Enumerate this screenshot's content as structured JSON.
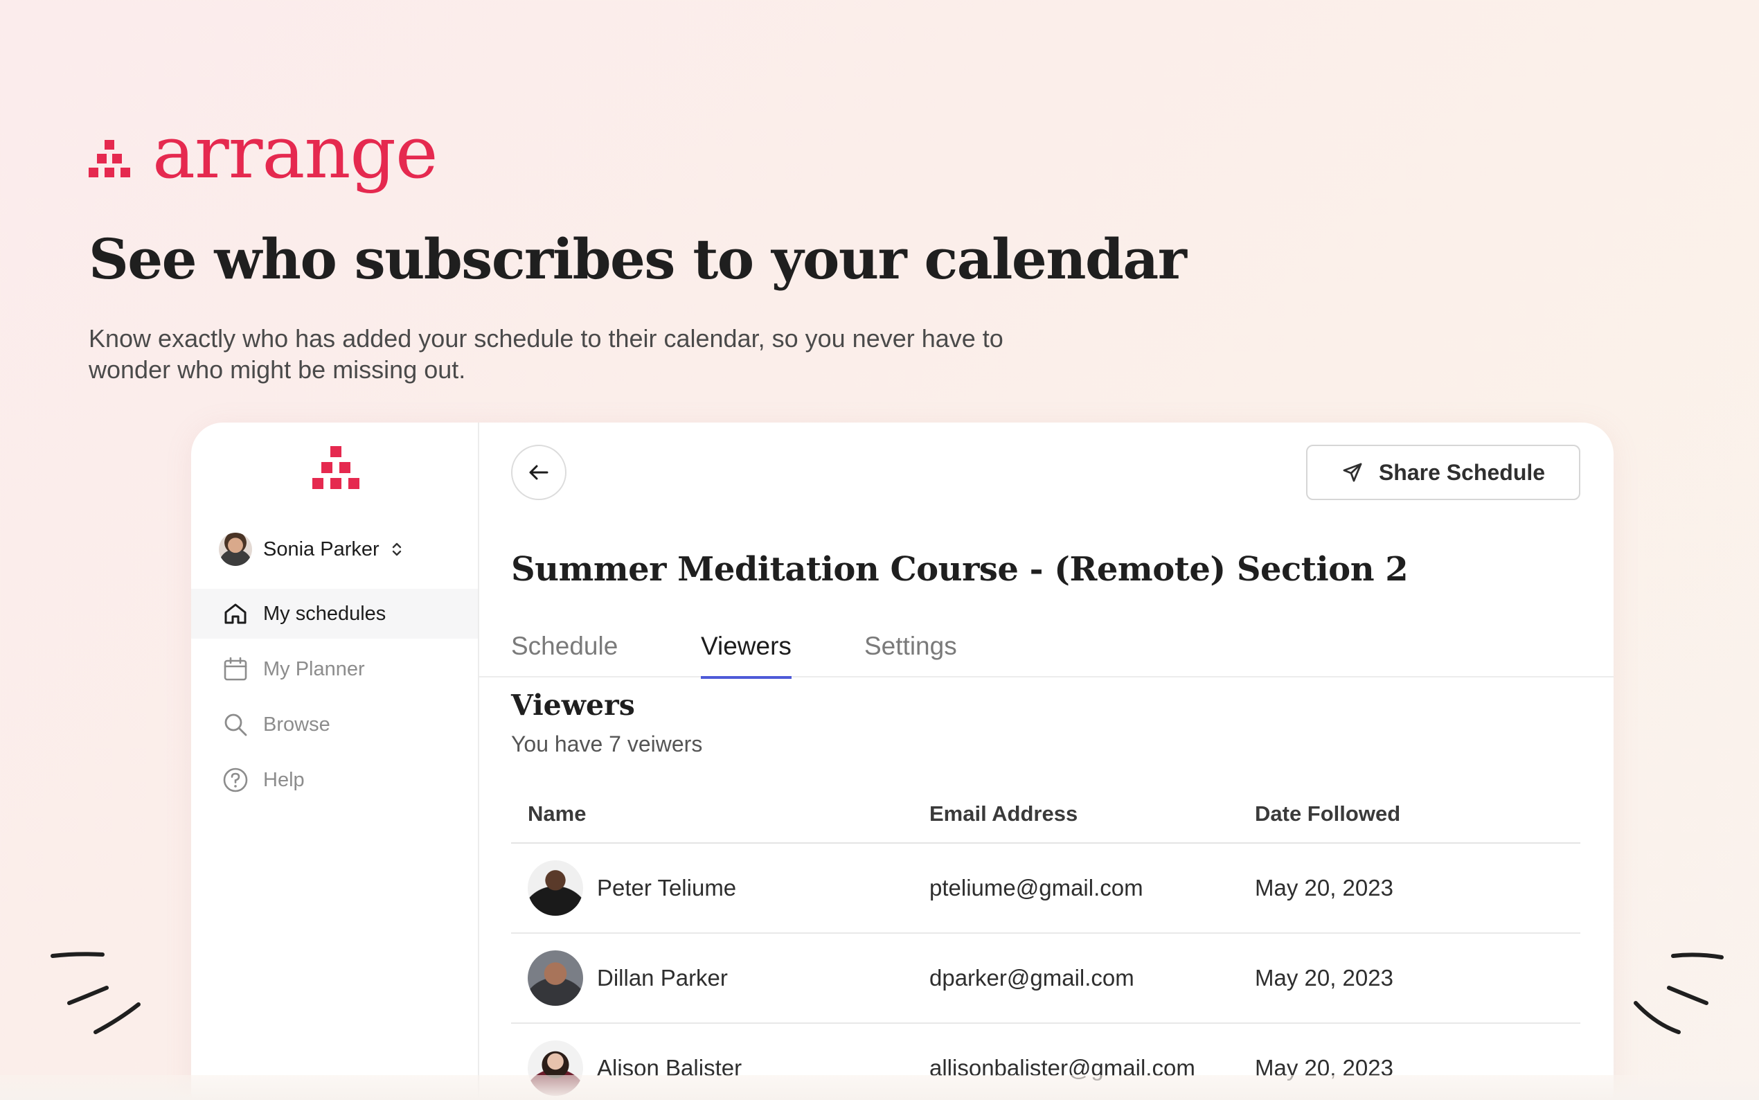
{
  "brand": {
    "name": "arrange",
    "color": "#e5294f"
  },
  "hero": {
    "headline": "See who subscribes to your calendar",
    "subhead": "Know exactly who has added your schedule to their calendar, so you never have to wonder who might be missing out."
  },
  "sidebar": {
    "user": {
      "name": "Sonia Parker"
    },
    "items": [
      {
        "label": "My schedules",
        "icon": "home-icon",
        "active": true
      },
      {
        "label": "My Planner",
        "icon": "calendar-icon",
        "active": false
      },
      {
        "label": "Browse",
        "icon": "search-icon",
        "active": false
      },
      {
        "label": "Help",
        "icon": "help-icon",
        "active": false
      }
    ]
  },
  "toolbar": {
    "share_label": "Share Schedule",
    "back_icon": "arrow-left-icon",
    "share_icon": "send-icon"
  },
  "course": {
    "title": "Summer Meditation Course - (Remote) Section 2"
  },
  "tabs": [
    {
      "label": "Schedule",
      "active": false
    },
    {
      "label": "Viewers",
      "active": true
    },
    {
      "label": "Settings",
      "active": false
    }
  ],
  "viewers": {
    "title": "Viewers",
    "summary": "You have 7 veiwers",
    "columns": [
      "Name",
      "Email Address",
      "Date Followed"
    ],
    "rows": [
      {
        "name": "Peter Teliume",
        "email": "pteliume@gmail.com",
        "date": "May 20, 2023"
      },
      {
        "name": "Dillan Parker",
        "email": "dparker@gmail.com",
        "date": "May 20, 2023"
      },
      {
        "name": "Alison Balister",
        "email": "allisonbalister@gmail.com",
        "date": "May 20, 2023"
      }
    ]
  },
  "colors": {
    "accent_tab": "#4e5ad8",
    "brand_red": "#e5294f"
  }
}
